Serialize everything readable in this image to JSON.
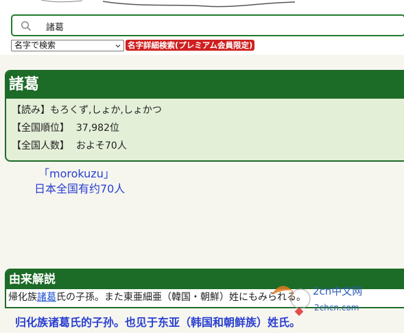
{
  "search": {
    "value": "諸葛"
  },
  "mode_select": {
    "selected": "名字で検索"
  },
  "premium_button": {
    "label": "名字詳細検索(プレミアム会員限定)"
  },
  "surname_card": {
    "title": "諸葛",
    "rows": [
      {
        "label": "【読み】",
        "value": "もろくず,しょか,しょかつ"
      },
      {
        "label": "【全国順位】",
        "value": "37,982位"
      },
      {
        "label": "【全国人数】",
        "value": "およそ70人"
      }
    ]
  },
  "subtitles": {
    "reading": "「morokuzu」",
    "population": "日本全国有约70人"
  },
  "origin": {
    "heading": "由来解説",
    "text_before": "帰化族",
    "link": "諸葛",
    "text_after": "氏の子孫。また東亜細亜（韓国・朝鮮）姓にもみられる。"
  },
  "translation_line": "归化族诸葛氏的子孙。也见于东亚（韩国和朝鲜族）姓氏。",
  "watermark": {
    "line1": "2ch中文网",
    "line2": "2chcn.com"
  },
  "colors": {
    "brand_green": "#1c6b27",
    "card_bg": "#e4efd8",
    "premium_red": "#cf2020",
    "translation_blue": "#2a3fd0"
  }
}
